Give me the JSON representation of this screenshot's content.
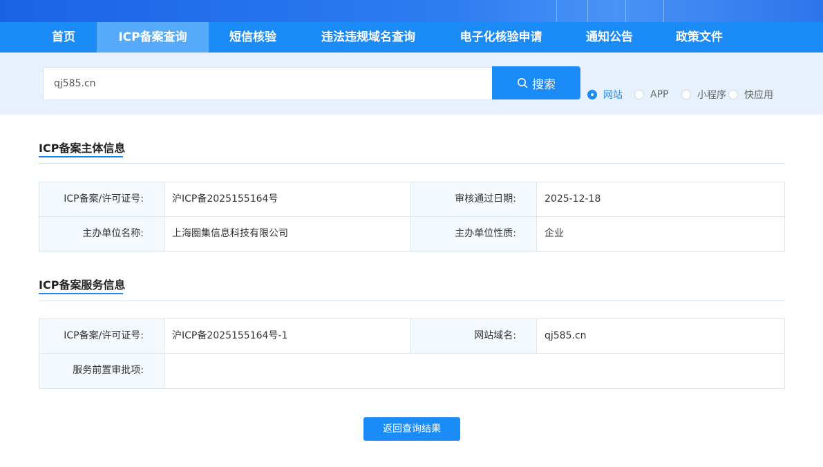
{
  "nav": {
    "items": [
      {
        "label": "首页"
      },
      {
        "label": "ICP备案查询"
      },
      {
        "label": "短信核验"
      },
      {
        "label": "违法违规域名查询"
      },
      {
        "label": "电子化核验申请"
      },
      {
        "label": "通知公告"
      },
      {
        "label": "政策文件"
      }
    ],
    "active_index": 1
  },
  "search": {
    "value": "qj585.cn",
    "button_label": "搜索",
    "button_icon": "search-icon",
    "types": [
      {
        "label": "网站",
        "checked": true
      },
      {
        "label": "APP",
        "checked": false
      },
      {
        "label": "小程序",
        "checked": false
      },
      {
        "label": "快应用",
        "checked": false
      }
    ]
  },
  "subject": {
    "title": "ICP备案主体信息",
    "license_label": "ICP备案/许可证号:",
    "license_value": "沪ICP备2025155164号",
    "approve_date_label": "审核通过日期:",
    "approve_date_value": "2025-12-18",
    "org_name_label": "主办单位名称:",
    "org_name_value": "上海圈集信息科技有限公司",
    "org_type_label": "主办单位性质:",
    "org_type_value": "企业"
  },
  "service": {
    "title": "ICP备案服务信息",
    "license_label": "ICP备案/许可证号:",
    "license_value": "沪ICP备2025155164号-1",
    "domain_label": "网站域名:",
    "domain_value": "qj585.cn",
    "pre_approval_label": "服务前置审批项:",
    "pre_approval_value": ""
  },
  "back_button_label": "返回查询结果",
  "colors": {
    "primary": "#1b8cf7",
    "nav_active": "#55aaf9",
    "search_band": "#e6f1fd",
    "label_cell": "#f4f9fe"
  }
}
